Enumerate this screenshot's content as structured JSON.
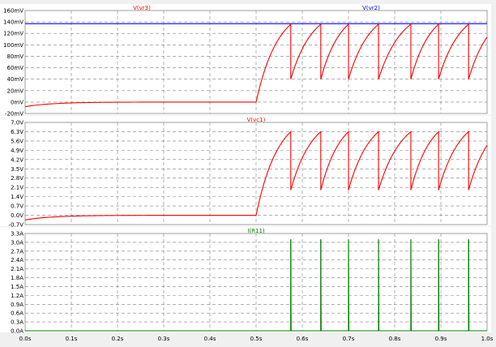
{
  "chart_data": [
    {
      "type": "line",
      "title": "",
      "xlabel": "",
      "ylabel": "",
      "xlim": [
        0,
        1.0
      ],
      "ylim": [
        -20,
        160
      ],
      "y_unit": "mV",
      "grid": true,
      "legend": "top",
      "y_ticks": [
        "160mV",
        "140mV",
        "120mV",
        "100mV",
        "80mV",
        "60mV",
        "40mV",
        "20mV",
        "0mV",
        "-20mV"
      ],
      "series": [
        {
          "name": "V(vr3)",
          "color": "#ff0000",
          "style": "sawtooth",
          "initial": -8,
          "settle": 0,
          "settle_tau": 0.06,
          "step_time": 0.5,
          "rise_end": 0.575,
          "peak": 136,
          "min": 40,
          "resets": [
            0.575,
            0.64,
            0.7,
            0.765,
            0.835,
            0.895,
            0.96
          ]
        },
        {
          "name": "V(vr2)",
          "color": "#0000ff",
          "style": "flat",
          "value": 137
        }
      ]
    },
    {
      "type": "line",
      "title": "",
      "xlabel": "",
      "ylabel": "",
      "xlim": [
        0,
        1.0
      ],
      "ylim": [
        -0.7,
        7.0
      ],
      "y_unit": "V",
      "grid": true,
      "legend": "top",
      "y_ticks": [
        "7.0V",
        "6.3V",
        "5.6V",
        "4.9V",
        "4.2V",
        "3.5V",
        "2.8V",
        "2.1V",
        "1.4V",
        "0.7V",
        "0.0V",
        "-0.7V"
      ],
      "series": [
        {
          "name": "V(vc1)",
          "color": "#ff0000",
          "style": "sawtooth",
          "initial": -0.35,
          "settle": 0.0,
          "settle_tau": 0.06,
          "step_time": 0.5,
          "rise_end": 0.575,
          "peak": 6.3,
          "min": 1.9,
          "resets": [
            0.575,
            0.64,
            0.7,
            0.765,
            0.835,
            0.895,
            0.96
          ]
        }
      ]
    },
    {
      "type": "line",
      "title": "",
      "xlabel": "",
      "ylabel": "",
      "xlim": [
        0,
        1.0
      ],
      "ylim": [
        0,
        3.3
      ],
      "y_unit": "A",
      "grid": true,
      "legend": "top",
      "y_ticks": [
        "3.3A",
        "3.0A",
        "2.7A",
        "2.4A",
        "2.1A",
        "1.8A",
        "1.5A",
        "1.2A",
        "0.9A",
        "0.6A",
        "0.3A",
        "0.0A"
      ],
      "x_ticks": [
        "0.0s",
        "0.1s",
        "0.2s",
        "0.3s",
        "0.4s",
        "0.5s",
        "0.6s",
        "0.7s",
        "0.8s",
        "0.9s",
        "1.0s"
      ],
      "series": [
        {
          "name": "I(R11)",
          "color": "#008000",
          "style": "spikes",
          "baseline": 0.0,
          "spike_value": 3.1,
          "spikes": [
            0.575,
            0.64,
            0.7,
            0.765,
            0.835,
            0.895,
            0.96
          ]
        }
      ]
    }
  ]
}
